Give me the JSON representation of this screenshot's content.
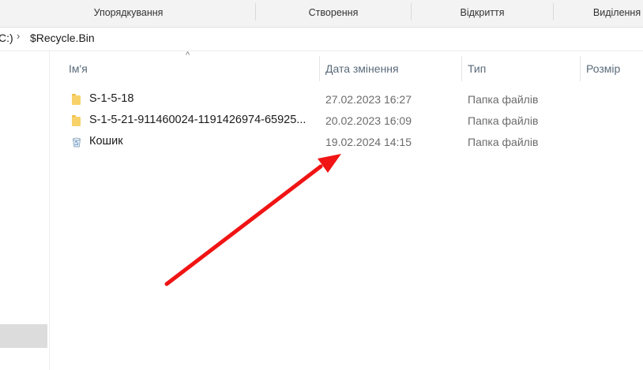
{
  "ribbon": {
    "groups": [
      "Упорядкування",
      "Створення",
      "Відкриття",
      "Виділення"
    ]
  },
  "address": {
    "drive": "C:)",
    "folder": "$Recycle.Bin"
  },
  "columns": {
    "name": "Ім'я",
    "date": "Дата змінення",
    "type": "Тип",
    "size": "Розмір"
  },
  "files": [
    {
      "name": "S-1-5-18",
      "date": "27.02.2023 16:27",
      "type": "Папка файлів",
      "icon": "folder-icon"
    },
    {
      "name": "S-1-5-21-911460024-1191426974-65925...",
      "date": "20.02.2023 16:09",
      "type": "Папка файлів",
      "icon": "folder-icon"
    },
    {
      "name": "Кошик",
      "date": "19.02.2024 14:15",
      "type": "Папка файлів",
      "icon": "recycle-bin-icon"
    }
  ],
  "colors": {
    "annotation_arrow": "#f01414",
    "folder": "#f7d26a"
  }
}
